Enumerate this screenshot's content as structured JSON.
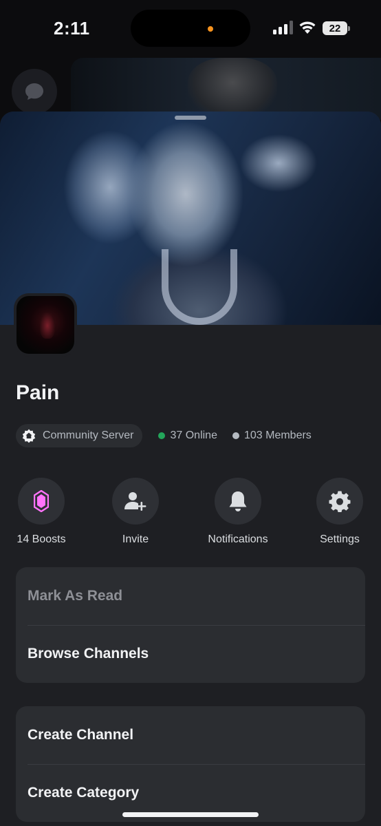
{
  "status_bar": {
    "time": "2:11",
    "battery": "22"
  },
  "server": {
    "name": "Pain",
    "community_label": "Community Server",
    "online": "37 Online",
    "members": "103 Members"
  },
  "actions": [
    {
      "label": "14 Boosts",
      "icon": "boost-gem-icon",
      "accent": "#ff73fa"
    },
    {
      "label": "Invite",
      "icon": "invite-user-icon"
    },
    {
      "label": "Notifications",
      "icon": "bell-icon"
    },
    {
      "label": "Settings",
      "icon": "gear-icon"
    }
  ],
  "menu": {
    "group1": [
      {
        "label": "Mark As Read",
        "dimmed": true
      },
      {
        "label": "Browse Channels"
      }
    ],
    "group2": [
      {
        "label": "Create Channel"
      },
      {
        "label": "Create Category"
      }
    ]
  },
  "colors": {
    "sheet_bg": "#1e1f23",
    "card_bg": "#2b2d31",
    "online_green": "#23a55a",
    "boost_pink": "#ff73fa"
  }
}
